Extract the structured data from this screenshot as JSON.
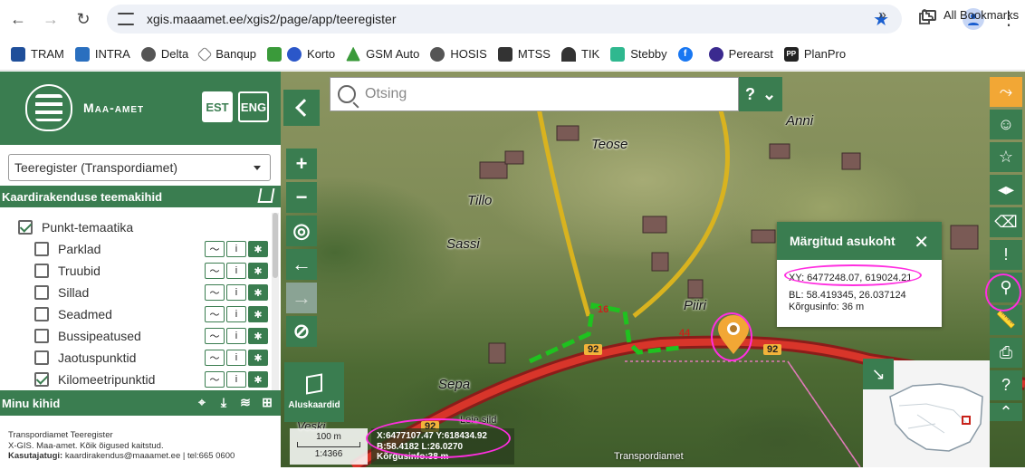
{
  "browser": {
    "url": "xgis.maaamet.ee/xgis2/page/app/teeregister",
    "bookmarks": [
      {
        "label": "TRAM",
        "color": "#1f4f9a"
      },
      {
        "label": "INTRA",
        "color": "#2a6fbf"
      },
      {
        "label": "Delta",
        "color": "#555555"
      },
      {
        "label": "Banqup",
        "color": "#777777"
      },
      {
        "label": "Korto",
        "color": "#2b57c9"
      },
      {
        "label": "GSM Auto",
        "color": "#3a9a3a"
      },
      {
        "label": "HOSIS",
        "color": "#555555"
      },
      {
        "label": "MTSS",
        "color": "#333333"
      },
      {
        "label": "TIK",
        "color": "#333333"
      },
      {
        "label": "Stebby",
        "color": "#2fb88f"
      },
      {
        "label": "Facebook",
        "color": "#1877f2"
      },
      {
        "label": "Perearst",
        "color": "#3b2a8f"
      },
      {
        "label": "PlanPro",
        "color": "#222222"
      }
    ],
    "all_bookmarks": "All Bookmarks"
  },
  "sidebar": {
    "title": "Maa-amet",
    "lang_est": "EST",
    "lang_eng": "ENG",
    "app_select": "Teeregister (Transpordiamet)",
    "themes_title": "Kaardirakenduse teemakihid",
    "parent_layer": {
      "label": "Punkt-temaatika",
      "checked": true
    },
    "layers": [
      {
        "label": "Parklad",
        "checked": false
      },
      {
        "label": "Truubid",
        "checked": false
      },
      {
        "label": "Sillad",
        "checked": false
      },
      {
        "label": "Seadmed",
        "checked": false
      },
      {
        "label": "Bussipeatused",
        "checked": false
      },
      {
        "label": "Jaotuspunktid",
        "checked": false
      },
      {
        "label": "Kilomeetripunktid",
        "checked": true
      }
    ],
    "tool_info": "i",
    "my_layers": "Minu kihid",
    "footer_line1": "Transpordiamet Teeregister",
    "footer_line2": "X-GIS. Maa-amet. Kõik õigused kaitstud.",
    "footer_contact_label": "Kasutajatugi:",
    "footer_contact": "kaardirakendus@maaamet.ee | tel:665 0600"
  },
  "map": {
    "search_placeholder": "Otsing",
    "search_help": "?",
    "basemap_label": "Aluskaardid",
    "labels": [
      "Teose",
      "Anni",
      "Tillo",
      "Sassi",
      "Piiri",
      "Sepa",
      "Veski",
      "Leie sild"
    ],
    "road_numbers": [
      "92",
      "92",
      "92",
      "16",
      "44"
    ],
    "scale_distance": "100 m",
    "scale_ratio": "1:4366",
    "cursor_coords": "X:6477107.47 Y:618434.92",
    "cursor_bl": "B:58.4182 L:26.0270",
    "cursor_height": "Kõrgusinfo:38 m",
    "attribution": "Transpordiamet",
    "help": "?"
  },
  "popup": {
    "title": "Märgitud asukoht",
    "xy": "XY: 6477248.07, 619024.21",
    "bl": "BL: 58.419345, 26.037124",
    "height": "Kõrgusinfo: 36 m"
  },
  "colors": {
    "brand_green": "#3a7d50",
    "accent_orange": "#f2a735",
    "annotation_magenta": "#ff2ee0",
    "road_red": "#c8221a"
  }
}
